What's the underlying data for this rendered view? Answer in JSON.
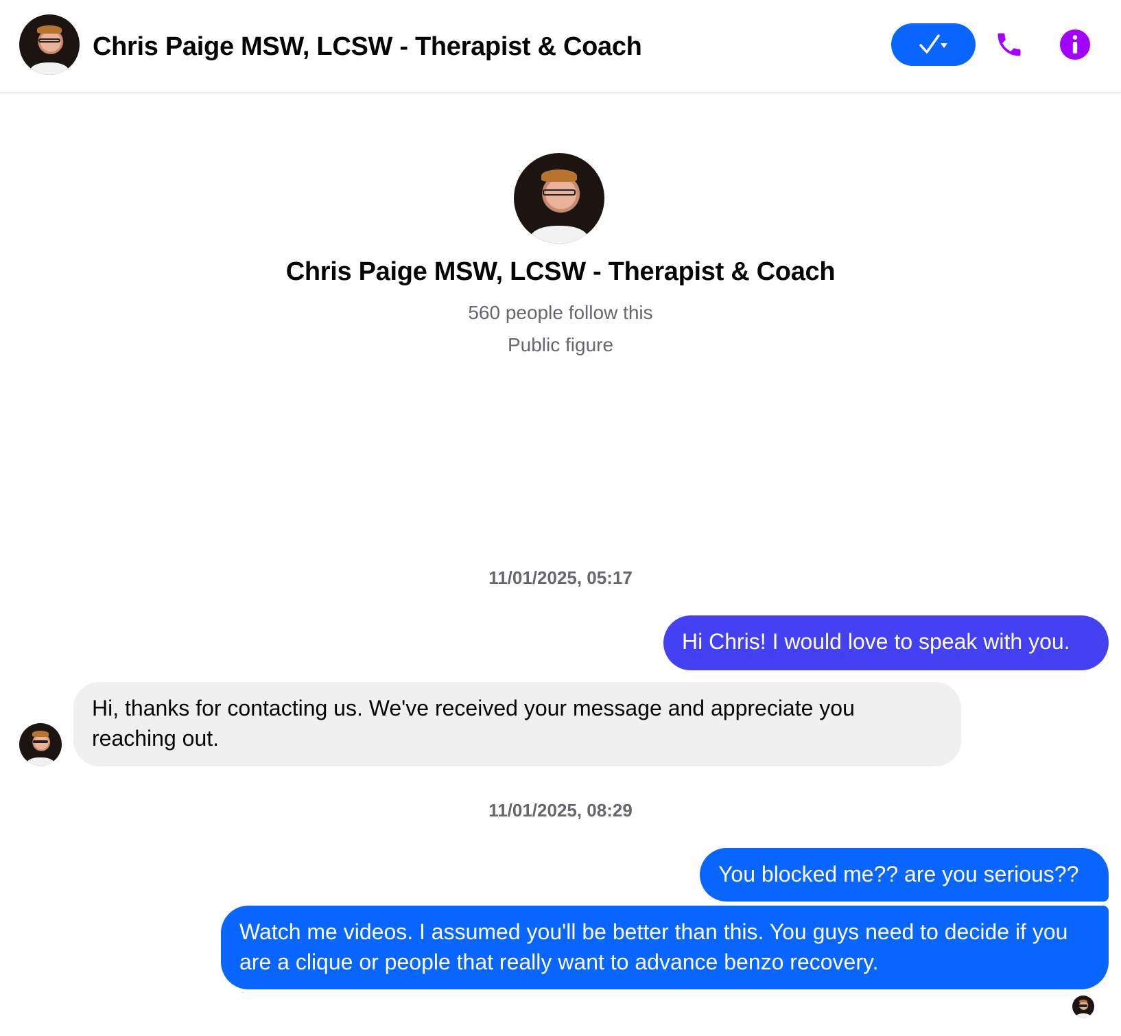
{
  "header": {
    "title": "Chris Paige MSW, LCSW - Therapist & Coach",
    "accent_color": "#0866ff",
    "icon_color": "#a200ff"
  },
  "profile": {
    "name": "Chris Paige MSW, LCSW - Therapist & Coach",
    "followers": "560 people follow this",
    "category": "Public figure"
  },
  "conversation": {
    "timestamps": [
      "11/01/2025, 05:17",
      "11/01/2025, 08:29"
    ],
    "messages": [
      {
        "from": "me",
        "text": "Hi Chris! I would love to speak with you.",
        "color": "#4441f2"
      },
      {
        "from": "them",
        "text": "Hi, thanks for contacting us. We've received your message and appreciate you reaching out."
      },
      {
        "from": "me",
        "text": "You blocked me?? are you serious??",
        "color": "#0866ff"
      },
      {
        "from": "me",
        "text": "Watch me videos. I assumed you'll be better than this. You guys need to decide if you are a clique or people that really want to advance benzo recovery.",
        "color": "#0866ff"
      }
    ]
  },
  "icons": [
    "checkmark-dropdown-icon",
    "phone-icon",
    "info-icon",
    "avatar",
    "read-receipt-avatar"
  ]
}
